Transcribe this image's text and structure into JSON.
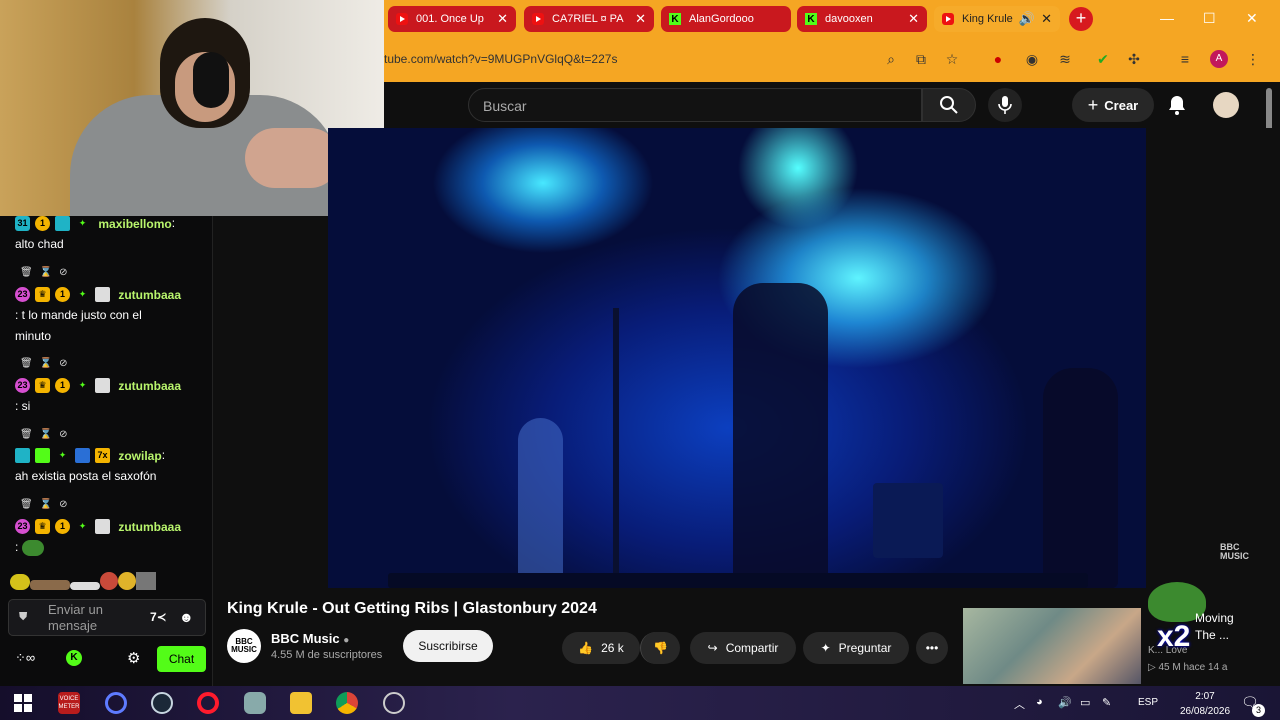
{
  "browser": {
    "tabs": [
      {
        "label": "001. Once Up",
        "icon": "youtube-icon"
      },
      {
        "label": "CA7RIEL ¤ PA",
        "icon": "youtube-icon"
      },
      {
        "label": "AlanGordooo",
        "icon": "kick-icon"
      },
      {
        "label": "davooxen",
        "icon": "kick-icon"
      },
      {
        "label": "King Krule",
        "icon": "youtube-icon"
      }
    ],
    "url": "tube.com/watch?v=9MUGPnVGlqQ&t=227s",
    "profile_initial": "A",
    "extension_count": "1"
  },
  "youtube": {
    "search_placeholder": "Buscar",
    "create_label": "Crear",
    "video_title": "King Krule - Out Getting Ribs | Glastonbury 2024",
    "channel_name": "BBC Music",
    "channel_logo": "BBC MUSIC",
    "subscribers": "4.55 M de suscriptores",
    "subscribe_label": "Suscribirse",
    "likes": "26 k",
    "share_label": "Compartir",
    "ask_label": "Preguntar",
    "watermark": "BBC MUSIC",
    "recommended": {
      "title_line1": "Moving",
      "title_line2": "The ...",
      "channel": "K... Love",
      "meta": "▷ 45 M  hace 14 a"
    },
    "overlay_text": "x2"
  },
  "chat": {
    "messages": [
      {
        "user": "maxibellomo",
        "text": "alto chad",
        "user_color": "#b9f56d"
      },
      {
        "user": "zutumbaaa",
        "text": ": t lo mande justo con el",
        "text2": "minuto",
        "user_color": "#b9f56d"
      },
      {
        "user": "zutumbaaa",
        "text": ": si",
        "user_color": "#b9f56d"
      },
      {
        "user": "zowilap",
        "text": "ah existia posta el saxofón",
        "user_color": "#b9f56d"
      },
      {
        "user": "zutumbaaa",
        "text": ":",
        "user_color": "#b9f56d"
      }
    ],
    "input_placeholder_line1": "Enviar un",
    "input_placeholder_line2": "mensaje",
    "chat_button": "Chat",
    "badge_gift_count": "31",
    "badge_sub_count": "23",
    "badge_1": "1",
    "badge_7x": "7x"
  },
  "taskbar": {
    "language": "ESP",
    "time": "2:07",
    "date": "26/08/2026",
    "notifications": "3",
    "voicemeeter_label": "VOICE METER"
  }
}
